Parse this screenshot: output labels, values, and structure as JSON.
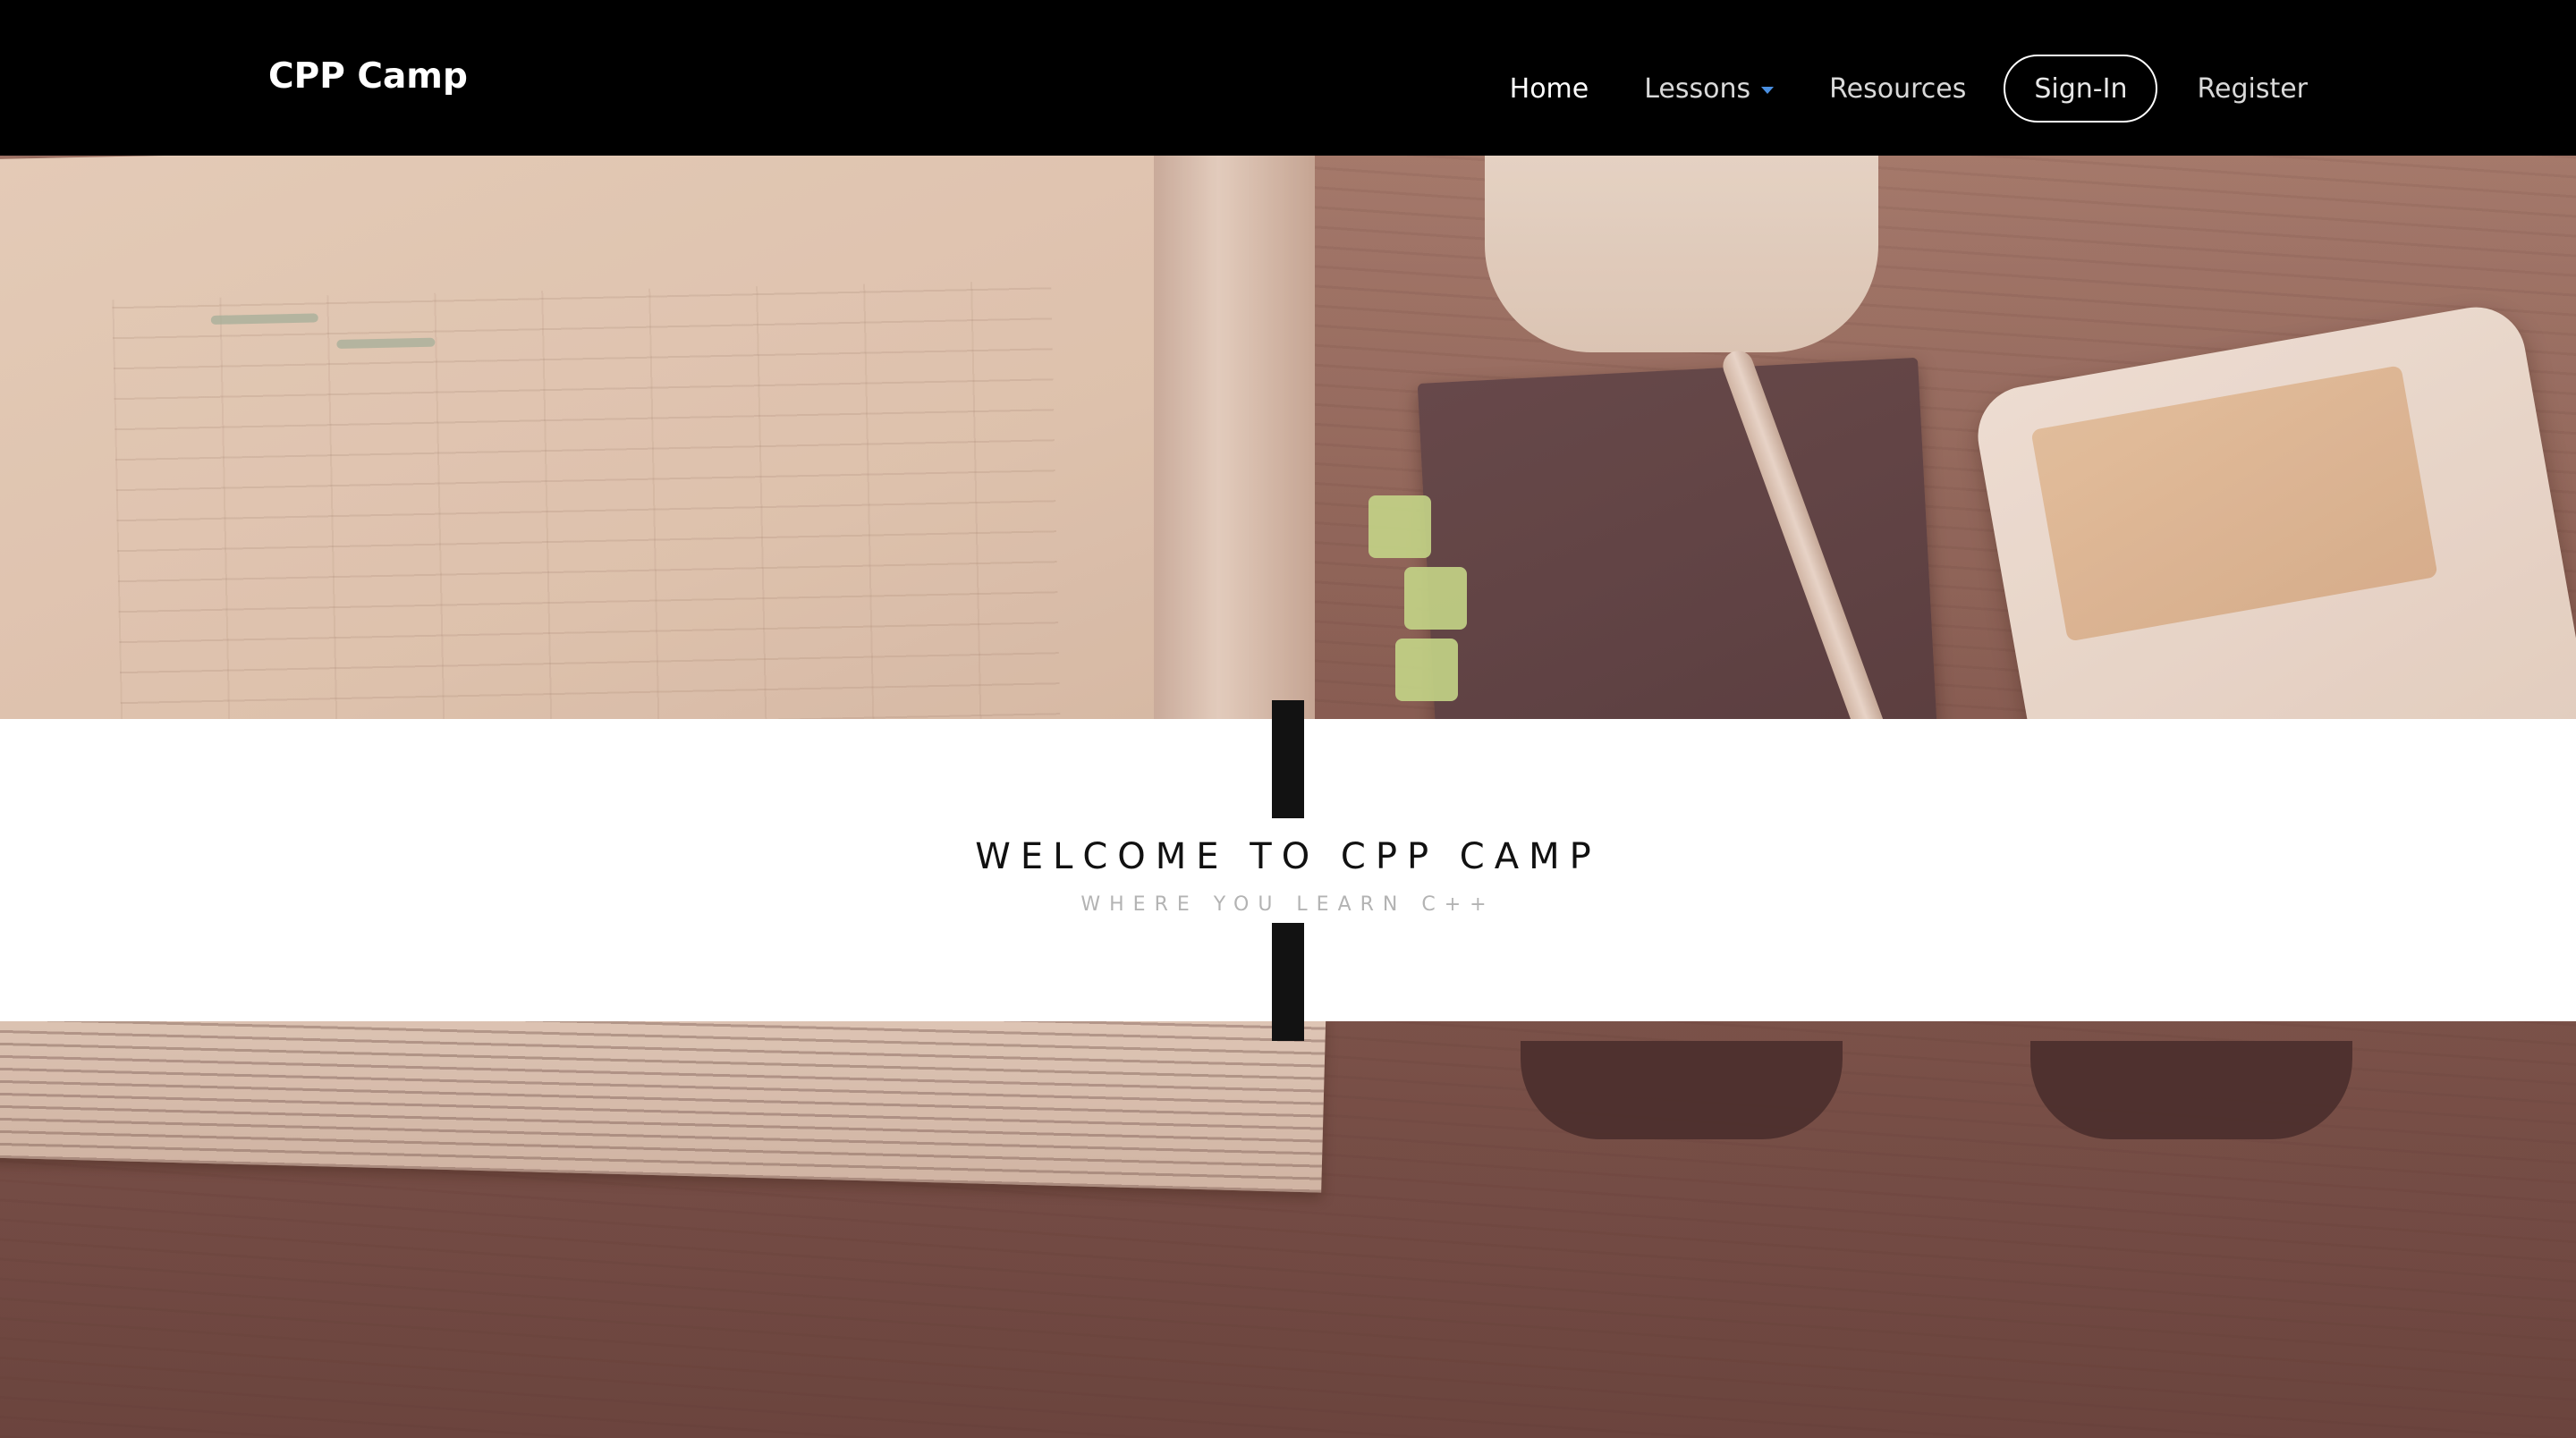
{
  "brand": {
    "name": "CPP Camp"
  },
  "nav": {
    "home": "Home",
    "lessons": "Lessons",
    "resources": "Resources",
    "signin": "Sign-In",
    "register": "Register",
    "caret_icon": "caret-down-icon",
    "caret_color": "#4a90e2"
  },
  "hero": {
    "title": "WELCOME TO CPP CAMP",
    "subtitle": "WHERE YOU LEARN C++"
  },
  "colors": {
    "navbar": "#000000",
    "band": "#ffffff",
    "accent_bar": "#121212"
  }
}
